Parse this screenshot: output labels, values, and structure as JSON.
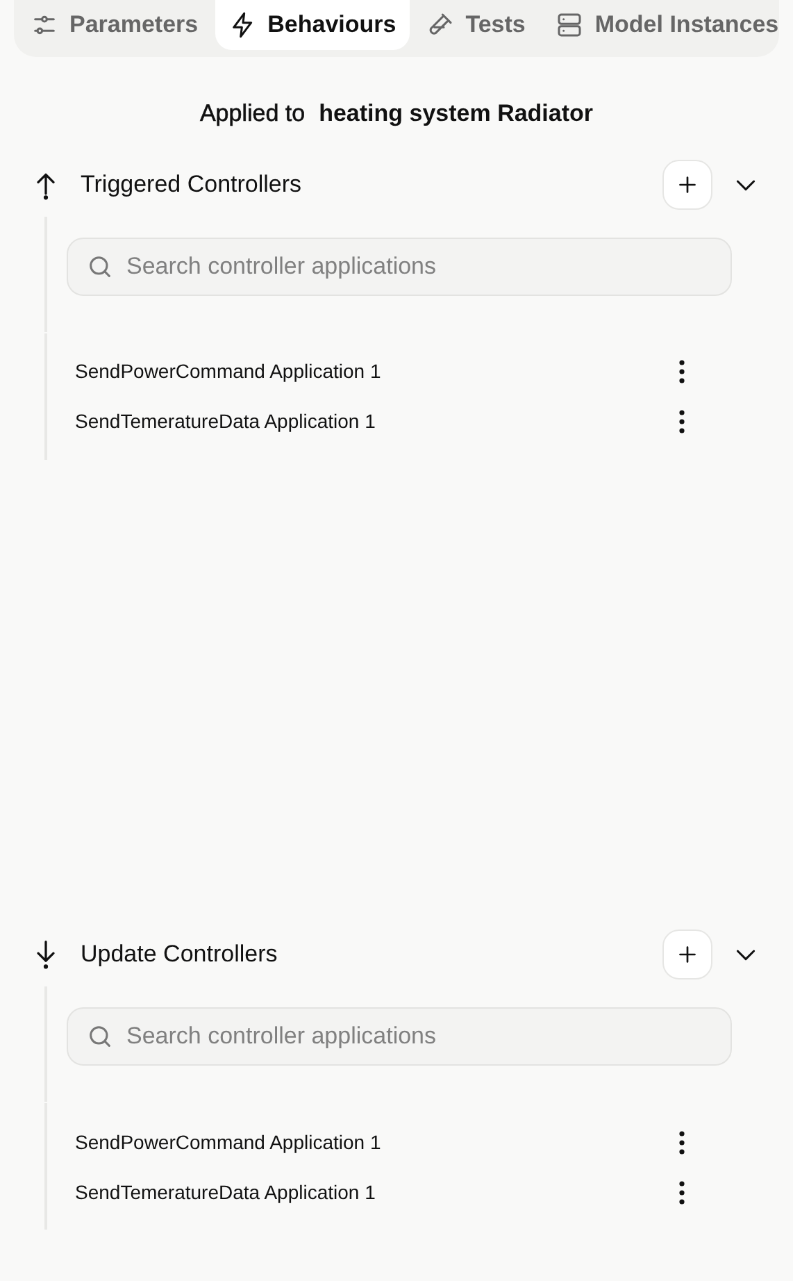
{
  "tabs": [
    {
      "label": "Parameters",
      "selected": false
    },
    {
      "label": "Behaviours",
      "selected": true
    },
    {
      "label": "Tests",
      "selected": false
    },
    {
      "label": "Model Instances",
      "selected": false
    }
  ],
  "applied_to": {
    "label": "Applied to",
    "target": "heating system Radiator"
  },
  "sections": [
    {
      "kind": "triggered",
      "title": "Triggered Controllers",
      "expanded": true,
      "search": {
        "placeholder": "Search controller applications"
      },
      "items": [
        {
          "name": "SendPowerCommand Application 1"
        },
        {
          "name": "SendTemeratureData Application 1"
        }
      ]
    },
    {
      "kind": "update",
      "title": "Update Controllers",
      "expanded": true,
      "search": {
        "placeholder": "Search controller applications"
      },
      "items": [
        {
          "name": "SendPowerCommand Application 1"
        },
        {
          "name": "SendTemeratureData Application 1"
        }
      ]
    }
  ]
}
